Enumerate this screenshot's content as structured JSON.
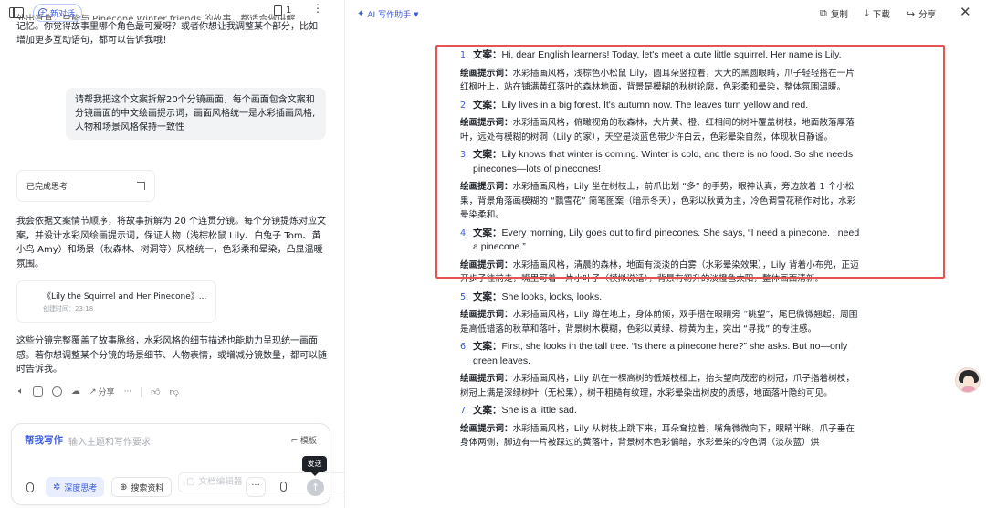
{
  "left": {
    "new_chat": "新对话",
    "doc_count": "1",
    "frag_cut": "外出覓食，只能与 Pinecone Winter friends 的故事，都适合做讲解",
    "frag_line1": "记忆。你觉得故事里哪个角色最可爱呀？或者你想让我调整某个部分，比如",
    "frag_line2": "增加更多互动语句，都可以告诉我哦！",
    "user_msg": "请帮我把这个文案拆解20个分镜画面，每个画面包含文案和分镜画面的中文绘画提示词，画面风格统一是水彩插画风格,人物和场景风格保持一致性",
    "thinking_done": "已完成思考",
    "reply_para1": "我会依据文案情节顺序，将故事拆解为 20 个连贯分镜。每个分镜提炼对应文案，并设计水彩风绘画提示词，保证人物（浅棕松鼠 Lily、白兔子 Tom、黄小鸟 Amy）和场景（秋森林、树洞等）风格统一，色彩柔和晕染，凸显温暖氛围。",
    "file_title": "《Lily the Squirrel and Her Pinecone》...",
    "file_meta": "创建时间：23:18",
    "reply_para2": "这些分镜完整覆盖了故事脉络，水彩风格的细节描述也能助力呈现统一画面感。若你想调整某个分镜的场景细节、人物表情，或增减分镜数量，都可以随时告诉我。",
    "share_label": "分享",
    "input": {
      "mode": "帮我写作",
      "placeholder": "输入主题和写作要求",
      "template": "模板",
      "deep_think": "深度思考",
      "search": "搜索资料",
      "doc_edit": "文档编辑器",
      "send_tip": "发送"
    }
  },
  "right": {
    "assistant": "AI 写作助手",
    "copy": "复制",
    "download": "下载",
    "share": "分享",
    "items": [
      {
        "num": "1.",
        "copy_label": "文案：",
        "copy": "Hi, dear English learners! Today, let's meet a cute little squirrel. Her name is Lily.",
        "prompt_label": "绘画提示词：",
        "prompt": "水彩插画风格，浅棕色小松鼠 Lily，圆耳朵竖拉着，大大的黑圆眼睛，爪子轻轻搭在一片红枫叶上，站在铺满黄红落叶的森林地面，背景是模糊的秋树轮廓，色彩柔和晕染，整体氛围温暖。"
      },
      {
        "num": "2.",
        "copy_label": "文案：",
        "copy": "Lily lives in a big forest. It's autumn now. The leaves turn yellow and red.",
        "prompt_label": "绘画提示词：",
        "prompt": "水彩插画风格，俯瞰视角的秋森林，大片黄、橙、红相间的树叶覆盖树枝，地面散落厚落叶，远处有模糊的树洞（Lily 的家），天空是淡蓝色带少许白云，色彩晕染自然，体现秋日静谧。"
      },
      {
        "num": "3.",
        "copy_label": "文案：",
        "copy": "Lily knows that winter is coming. Winter is cold, and there is no food. So she needs pinecones—lots of pinecones!",
        "prompt_label": "绘画提示词：",
        "prompt": "水彩插画风格，Lily 坐在树枝上，前爪比划 “多” 的手势，眼神认真，旁边放着 1 个小松果，背景角落画模糊的 “飘雪花” 简笔图案（暗示冬天），色彩以秋黄为主，冷色调雪花稍作对比，水彩晕染柔和。"
      },
      {
        "num": "4.",
        "copy_label": "文案：",
        "copy": "Every morning, Lily goes out to find pinecones. She says, “I need a pinecone. I need a pinecone.”",
        "prompt_label": "绘画提示词：",
        "prompt": "水彩插画风格，清晨的森林，地面有淡淡的白雾（水彩晕染效果），Lily 背着小布兜，正迈开步子往前走，嘴里可着一片小叶子（模拟说话），背景有初升的淡橙色太阳，整体画面清新。"
      },
      {
        "num": "5.",
        "copy_label": "文案：",
        "copy": "She looks, looks, looks.",
        "prompt_label": "绘画提示词：",
        "prompt": "水彩插画风格，Lily 蹲在地上，身体前倾，双手搭在眼睛旁 “眺望”，尾巴微微翘起，周围是高低错落的秋草和落叶，背景树木模糊，色彩以黄绿、棕黄为主，突出 “寻找” 的专注感。"
      },
      {
        "num": "6.",
        "copy_label": "文案：",
        "copy": "First, she looks in the tall tree. “Is there a pinecone here?” she asks. But no—only green leaves.",
        "prompt_label": "绘画提示词：",
        "prompt": "水彩插画风格，Lily 趴在一棵高树的低矮枝桠上，抬头望向茂密的树冠，爪子指着树枝，树冠上满是深绿树叶（无松果），树干粗糙有纹理，水彩晕染出树皮的质感，地面落叶隐约可见。"
      },
      {
        "num": "7.",
        "copy_label": "文案：",
        "copy": "She is a little sad.",
        "prompt_label": "绘画提示词：",
        "prompt": "水彩插画风格，Lily 从树枝上跳下来，耳朵耷拉着，嘴角微微向下，眼睛半眯，爪子垂在身体两侧，脚边有一片被踩过的黄落叶，背景树木色彩偏暗，水彩晕染的冷色调（淡灰蓝）烘"
      }
    ]
  }
}
